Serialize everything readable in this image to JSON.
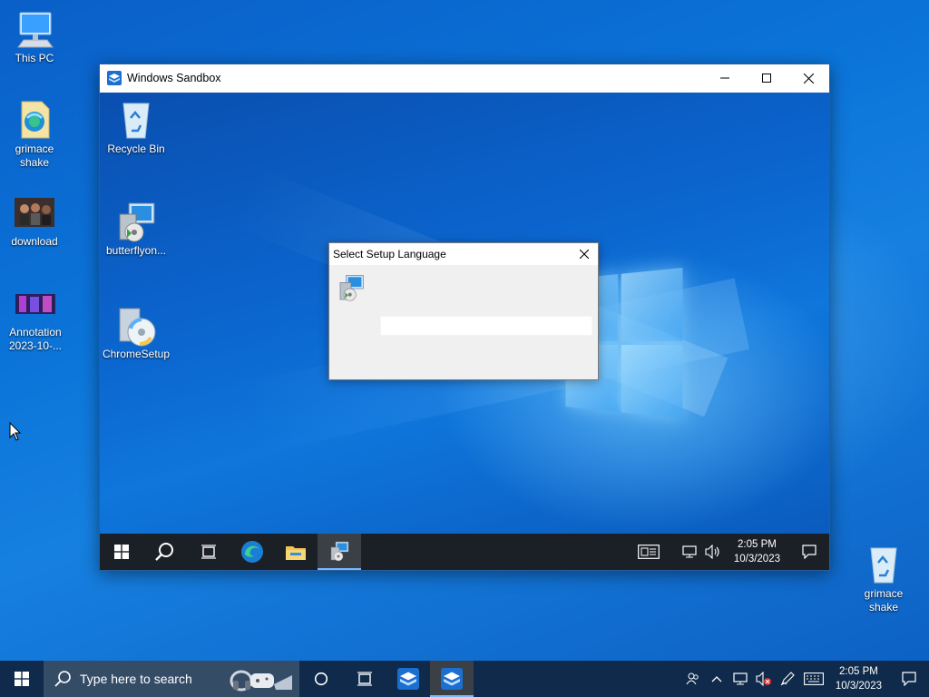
{
  "host_desktop": {
    "icons": [
      {
        "id": "this-pc",
        "label": "This PC"
      },
      {
        "id": "grimace-shake-edge",
        "label": "grimace shake"
      },
      {
        "id": "download",
        "label": "download"
      },
      {
        "id": "annotation",
        "label": "Annotation 2023-10-..."
      },
      {
        "id": "recycle-right",
        "label": "grimace shake"
      }
    ]
  },
  "sandbox": {
    "title": "Windows Sandbox",
    "desktop_icons": [
      {
        "id": "recycle-bin",
        "label": "Recycle Bin"
      },
      {
        "id": "butterfly",
        "label": "butterflyon..."
      },
      {
        "id": "chrome-setup",
        "label": "ChromeSetup"
      }
    ],
    "dialog": {
      "title": "Select Setup Language",
      "selected_value": ""
    },
    "taskbar": {
      "time": "2:05 PM",
      "date": "10/3/2023"
    }
  },
  "taskbar": {
    "search_placeholder": "Type here to search",
    "time": "2:05 PM",
    "date": "10/3/2023"
  },
  "colors": {
    "accent": "#0b74d9",
    "taskbar": "#0f2a4a",
    "sandbox_taskbar": "#1b1f26"
  }
}
